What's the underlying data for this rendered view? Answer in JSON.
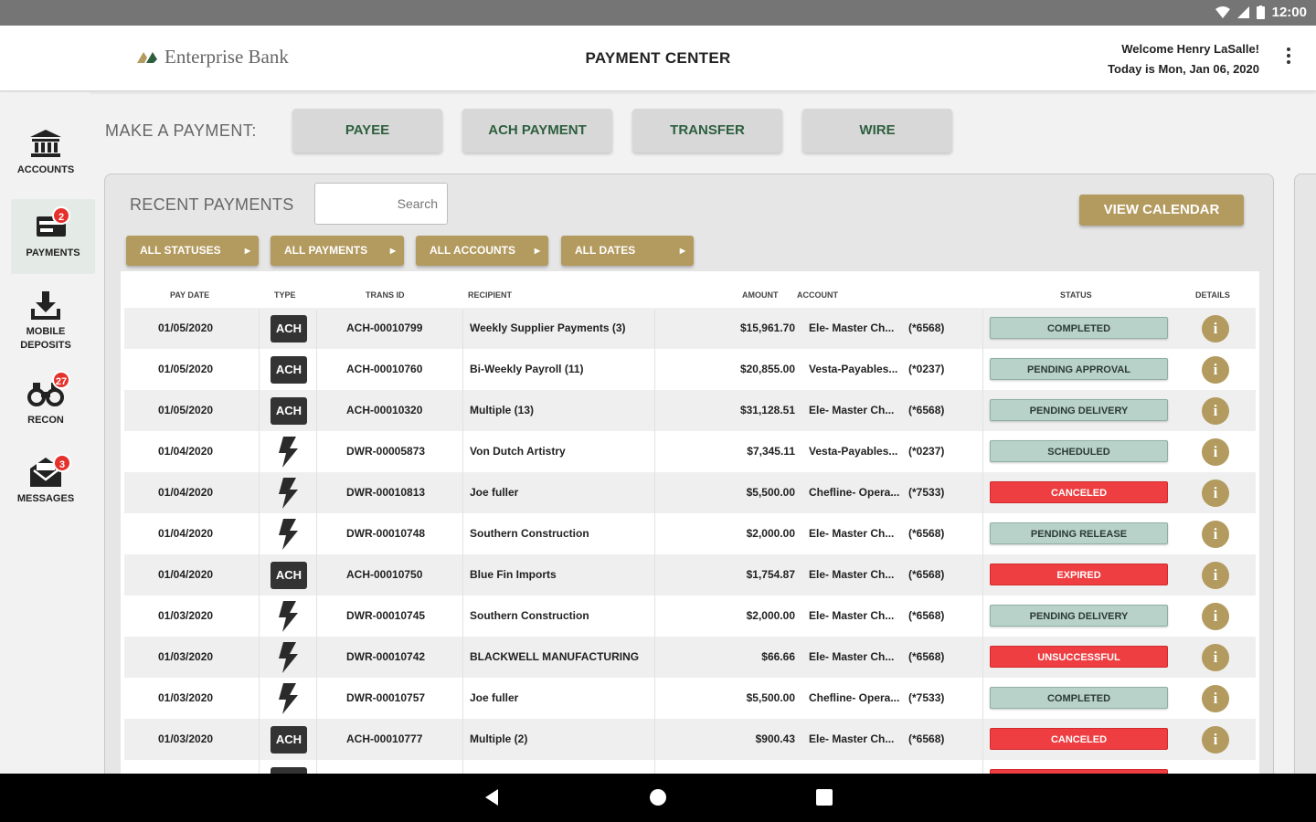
{
  "statusbar": {
    "time": "12:00"
  },
  "header": {
    "logo_text": "Enterprise Bank",
    "title": "PAYMENT CENTER",
    "welcome": "Welcome Henry LaSalle!",
    "date": "Today is Mon, Jan 06, 2020"
  },
  "sidebar": {
    "items": [
      {
        "label": "ACCOUNTS",
        "icon": "bank-icon"
      },
      {
        "label": "PAYMENTS",
        "icon": "payments-icon",
        "badge": "2"
      },
      {
        "label": "MOBILE DEPOSITS",
        "icon": "download-icon"
      },
      {
        "label": "RECON",
        "icon": "binoculars-icon",
        "badge": "27"
      },
      {
        "label": "MESSAGES",
        "icon": "envelope-icon",
        "badge": "3"
      }
    ]
  },
  "make_payment": {
    "label": "MAKE A PAYMENT:",
    "buttons": [
      "PAYEE",
      "ACH PAYMENT",
      "TRANSFER",
      "WIRE"
    ]
  },
  "recent": {
    "title": "RECENT PAYMENTS",
    "search_placeholder": "Search",
    "calendar_button": "VIEW CALENDAR",
    "filters": [
      "ALL STATUSES",
      "ALL PAYMENTS",
      "ALL ACCOUNTS",
      "ALL DATES"
    ]
  },
  "table": {
    "headers": {
      "pay_date": "PAY DATE",
      "type": "TYPE",
      "trans_id": "TRANS ID",
      "recipient": "RECIPIENT",
      "amount": "AMOUNT",
      "account": "ACCOUNT",
      "status": "STATUS",
      "details": "DETAILS"
    },
    "rows": [
      {
        "date": "01/05/2020",
        "type": "ACH",
        "id": "ACH-00010799",
        "recipient": "Weekly Supplier Payments (3)",
        "amount": "$15,961.70",
        "account": "Ele- Master Ch...",
        "acct_num": "(*6568)",
        "status": "COMPLETED",
        "status_kind": "ok"
      },
      {
        "date": "01/05/2020",
        "type": "ACH",
        "id": "ACH-00010760",
        "recipient": "Bi-Weekly Payroll (11)",
        "amount": "$20,855.00",
        "account": "Vesta-Payables...",
        "acct_num": "(*0237)",
        "status": "PENDING APPROVAL",
        "status_kind": "ok"
      },
      {
        "date": "01/05/2020",
        "type": "ACH",
        "id": "ACH-00010320",
        "recipient": "Multiple (13)",
        "amount": "$31,128.51",
        "account": "Ele- Master Ch...",
        "acct_num": "(*6568)",
        "status": "PENDING DELIVERY",
        "status_kind": "ok"
      },
      {
        "date": "01/04/2020",
        "type": "WIRE",
        "id": "DWR-00005873",
        "recipient": "Von Dutch Artistry",
        "amount": "$7,345.11",
        "account": "Vesta-Payables...",
        "acct_num": "(*0237)",
        "status": "SCHEDULED",
        "status_kind": "ok"
      },
      {
        "date": "01/04/2020",
        "type": "WIRE",
        "id": "DWR-00010813",
        "recipient": "Joe fuller",
        "amount": "$5,500.00",
        "account": "Chefline- Opera...",
        "acct_num": "(*7533)",
        "status": "CANCELED",
        "status_kind": "bad"
      },
      {
        "date": "01/04/2020",
        "type": "WIRE",
        "id": "DWR-00010748",
        "recipient": "Southern Construction",
        "amount": "$2,000.00",
        "account": "Ele- Master Ch...",
        "acct_num": "(*6568)",
        "status": "PENDING RELEASE",
        "status_kind": "ok"
      },
      {
        "date": "01/04/2020",
        "type": "ACH",
        "id": "ACH-00010750",
        "recipient": "Blue Fin Imports",
        "amount": "$1,754.87",
        "account": "Ele- Master Ch...",
        "acct_num": "(*6568)",
        "status": "EXPIRED",
        "status_kind": "bad"
      },
      {
        "date": "01/03/2020",
        "type": "WIRE",
        "id": "DWR-00010745",
        "recipient": "Southern Construction",
        "amount": "$2,000.00",
        "account": "Ele- Master Ch...",
        "acct_num": "(*6568)",
        "status": "PENDING DELIVERY",
        "status_kind": "ok"
      },
      {
        "date": "01/03/2020",
        "type": "WIRE",
        "id": "DWR-00010742",
        "recipient": "BLACKWELL MANUFACTURING",
        "amount": "$66.66",
        "account": "Ele- Master Ch...",
        "acct_num": "(*6568)",
        "status": "UNSUCCESSFUL",
        "status_kind": "bad"
      },
      {
        "date": "01/03/2020",
        "type": "WIRE",
        "id": "DWR-00010757",
        "recipient": "Joe fuller",
        "amount": "$5,500.00",
        "account": "Chefline- Opera...",
        "acct_num": "(*7533)",
        "status": "COMPLETED",
        "status_kind": "ok"
      },
      {
        "date": "01/03/2020",
        "type": "ACH",
        "id": "ACH-00010777",
        "recipient": "Multiple (2)",
        "amount": "$900.43",
        "account": "Ele- Master Ch...",
        "acct_num": "(*6568)",
        "status": "CANCELED",
        "status_kind": "bad"
      }
    ]
  },
  "colors": {
    "gold": "#b39a5e",
    "green_text": "#2d5f3e",
    "status_ok": "#b8d1c9",
    "status_bad": "#ee3e41"
  }
}
